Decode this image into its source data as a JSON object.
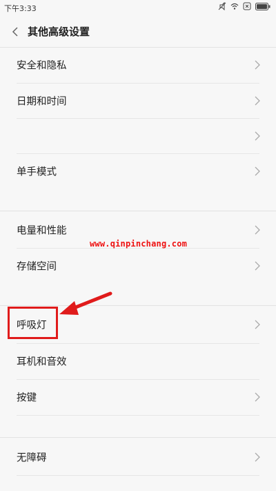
{
  "status_bar": {
    "time": "下午3:33"
  },
  "header": {
    "title": "其他高级设置"
  },
  "list": [
    {
      "label": "安全和隐私",
      "chevron": true
    },
    {
      "label": "日期和时间",
      "chevron": true
    },
    {
      "label": "",
      "chevron": true
    },
    {
      "label": "单手模式",
      "chevron": true
    },
    {
      "label": "电量和性能",
      "chevron": true
    },
    {
      "label": "存储空间",
      "chevron": true
    },
    {
      "label": "呼吸灯",
      "chevron": true
    },
    {
      "label": "耳机和音效",
      "chevron": false
    },
    {
      "label": "按键",
      "chevron": true
    },
    {
      "label": "无障碍",
      "chevron": true
    }
  ],
  "watermark": {
    "text": "www.qinpinchang.com"
  },
  "colors": {
    "annotation": "#e01b1b",
    "background": "#f7f7f7",
    "text": "#222222"
  }
}
